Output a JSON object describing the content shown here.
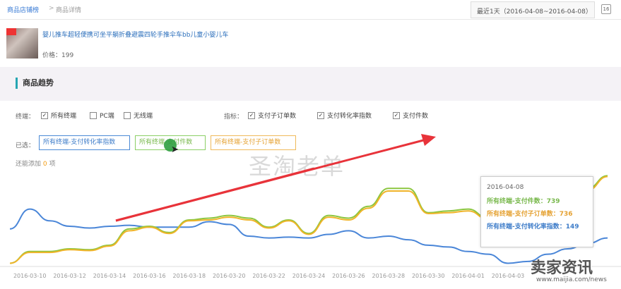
{
  "breadcrumb": {
    "first": "商品店铺榜",
    "sep": ">",
    "second": "商品详情"
  },
  "date_range": "最近1天（2016-04-08~2016-04-08）",
  "calendar_badge": "16",
  "product": {
    "title": "婴儿推车超轻便携可坐平躺折叠避震四轮手推伞车bb儿童小婴儿车",
    "price": "价格：199"
  },
  "section_title": "商品趋势",
  "filters": {
    "terminal_label": "终端：",
    "terminals": [
      {
        "label": "所有终端",
        "checked": true
      },
      {
        "label": "PC端",
        "checked": false
      },
      {
        "label": "无线端",
        "checked": false
      }
    ],
    "metric_label": "指标：",
    "metrics": [
      {
        "label": "支付子订单数",
        "checked": true
      },
      {
        "label": "支付转化率指数",
        "checked": true
      },
      {
        "label": "支付件数",
        "checked": true
      }
    ]
  },
  "selected": {
    "label": "已选：",
    "pills": [
      "所有终端-支付转化率指数",
      "所有终端-支付件数",
      "所有终端-支付子订单数"
    ]
  },
  "add_more": {
    "prefix": "还能添加",
    "count": "0",
    "suffix": "项"
  },
  "watermark": "圣淘老单",
  "tooltip": {
    "date": "2016-04-08",
    "rows": [
      {
        "text": "所有终端-支付件数：739",
        "color": "#7ab94e"
      },
      {
        "text": "所有终端-支付子订单数：736",
        "color": "#e5a233"
      },
      {
        "text": "所有终端-支付转化率指数：149",
        "color": "#3f7dc9"
      }
    ]
  },
  "brand": {
    "name": "卖家资讯",
    "url": "www.maijia.com/news"
  },
  "colors": {
    "blue": "#4a86d8",
    "green": "#8cc63f",
    "orange": "#f0b429",
    "arrow": "#e8333a"
  },
  "chart_data": {
    "type": "line",
    "x": [
      "2016-03-09",
      "2016-03-10",
      "2016-03-11",
      "2016-03-12",
      "2016-03-13",
      "2016-03-14",
      "2016-03-15",
      "2016-03-16",
      "2016-03-17",
      "2016-03-18",
      "2016-03-19",
      "2016-03-20",
      "2016-03-21",
      "2016-03-22",
      "2016-03-23",
      "2016-03-24",
      "2016-03-25",
      "2016-03-26",
      "2016-03-27",
      "2016-03-28",
      "2016-03-29",
      "2016-03-30",
      "2016-03-31",
      "2016-04-01",
      "2016-04-02",
      "2016-04-03",
      "2016-04-04",
      "2016-04-05",
      "2016-04-06",
      "2016-04-07",
      "2016-04-08"
    ],
    "x_tick_labels": [
      "2016-03-10",
      "2016-03-12",
      "2016-03-14",
      "2016-03-16",
      "2016-03-18",
      "2016-03-20",
      "2016-03-22",
      "2016-03-24",
      "2016-03-26",
      "2016-03-28",
      "2016-03-30",
      "2016-04-01",
      "2016-04-03"
    ],
    "x_tick_indices": [
      1,
      3,
      5,
      7,
      9,
      11,
      13,
      15,
      17,
      19,
      21,
      23,
      25
    ],
    "series": [
      {
        "name": "所有终端-支付转化率指数",
        "color": "#4a86d8",
        "values": [
          0.4,
          0.62,
          0.49,
          0.43,
          0.41,
          0.43,
          0.44,
          0.42,
          0.42,
          0.42,
          0.48,
          0.45,
          0.32,
          0.3,
          0.31,
          0.3,
          0.34,
          0.38,
          0.3,
          0.32,
          0.28,
          0.22,
          0.2,
          0.15,
          0.12,
          0.02,
          0.04,
          0.12,
          0.18,
          0.24,
          0.3
        ]
      },
      {
        "name": "所有终端-支付件数",
        "color": "#8cc63f",
        "values": [
          0.02,
          0.15,
          0.15,
          0.18,
          0.17,
          0.22,
          0.4,
          0.43,
          0.36,
          0.5,
          0.52,
          0.55,
          0.52,
          0.42,
          0.5,
          0.35,
          0.55,
          0.52,
          0.65,
          0.85,
          0.85,
          0.58,
          0.6,
          0.62,
          0.52,
          0.55,
          0.48,
          0.6,
          0.8,
          0.85,
          0.99
        ]
      },
      {
        "name": "所有终端-支付子订单数",
        "color": "#f0b429",
        "values": [
          0.02,
          0.14,
          0.14,
          0.17,
          0.16,
          0.21,
          0.38,
          0.42,
          0.35,
          0.49,
          0.5,
          0.53,
          0.5,
          0.41,
          0.49,
          0.34,
          0.53,
          0.5,
          0.63,
          0.82,
          0.82,
          0.57,
          0.58,
          0.6,
          0.51,
          0.54,
          0.46,
          0.58,
          0.78,
          0.83,
          0.98
        ]
      }
    ],
    "ylim": [
      0,
      1
    ],
    "grid": false
  }
}
